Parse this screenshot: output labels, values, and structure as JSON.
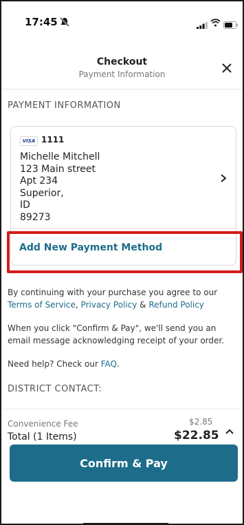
{
  "status_bar": {
    "time": "17:45"
  },
  "header": {
    "title": "Checkout",
    "subtitle": "Payment Information"
  },
  "section": {
    "payment_label": "PAYMENT INFORMATION",
    "district_label": "DISTRICT CONTACT:"
  },
  "card": {
    "brand": "VISA",
    "last4": "1111",
    "name": "Michelle Mitchell",
    "address_lines": [
      "123 Main street",
      "Apt 234",
      "Superior,",
      "ID",
      "89273"
    ],
    "add_new": "Add New Payment Method"
  },
  "legal": {
    "p1_prefix": "By continuing with your purchase you agree to our",
    "terms": "Terms of Service",
    "comma": ",",
    "privacy": "Privacy Policy",
    "amp": "&",
    "refund": "Refund Policy",
    "p2_line1": "When you click \"Confirm & Pay\", we'll send you an",
    "p2_line2": "email message acknowledging receipt of your order.",
    "help_prefix": "Need help? Check our",
    "faq": "FAQ",
    "help_suffix": "."
  },
  "summary": {
    "fee_label": "Convenience Fee",
    "fee_value": "$2.85",
    "total_label": "Total (1 Items)",
    "total_value": "$22.85"
  },
  "confirm_button": "Confirm & Pay",
  "colors": {
    "primary": "#1d6d8a",
    "highlight": "#d21b1b"
  },
  "icons": {
    "close": "close-icon",
    "chevron": "chevron-right-icon",
    "caret": "chevron-up-icon",
    "muted": "bell-muted-icon"
  }
}
